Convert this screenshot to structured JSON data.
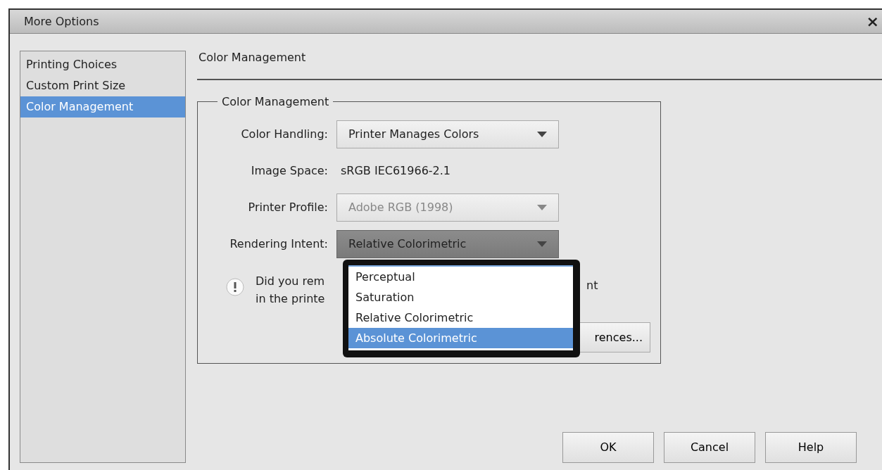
{
  "window": {
    "title": "More Options",
    "close": "×"
  },
  "sidebar": {
    "items": [
      {
        "label": "Printing Choices",
        "selected": false
      },
      {
        "label": "Custom Print Size",
        "selected": false
      },
      {
        "label": "Color Management",
        "selected": true
      }
    ]
  },
  "panel": {
    "title": "Color Management",
    "group": {
      "legend": "Color Management",
      "fields": [
        {
          "kind": "select",
          "label": "Color Handling:",
          "value": "Printer Manages Colors",
          "disabled": false,
          "expanded": false
        },
        {
          "kind": "text",
          "label": "Image Space:",
          "value": "sRGB IEC61966-2.1"
        },
        {
          "kind": "select",
          "label": "Printer Profile:",
          "value": "Adobe RGB (1998)",
          "disabled": true,
          "expanded": false
        },
        {
          "kind": "select",
          "label": "Rendering Intent:",
          "value": "Relative Colorimetric",
          "disabled": false,
          "expanded": true
        }
      ],
      "notice": {
        "lines": [
          "Did you rem",
          "in the printe"
        ],
        "tail": "nt"
      },
      "button": "rences..."
    },
    "dropdown": {
      "options": [
        {
          "label": "Perceptual",
          "selected": false
        },
        {
          "label": "Saturation",
          "selected": false
        },
        {
          "label": "Relative Colorimetric",
          "selected": false
        },
        {
          "label": "Absolute Colorimetric",
          "selected": true
        }
      ]
    }
  },
  "buttons": [
    "OK",
    "Cancel",
    "Help"
  ]
}
